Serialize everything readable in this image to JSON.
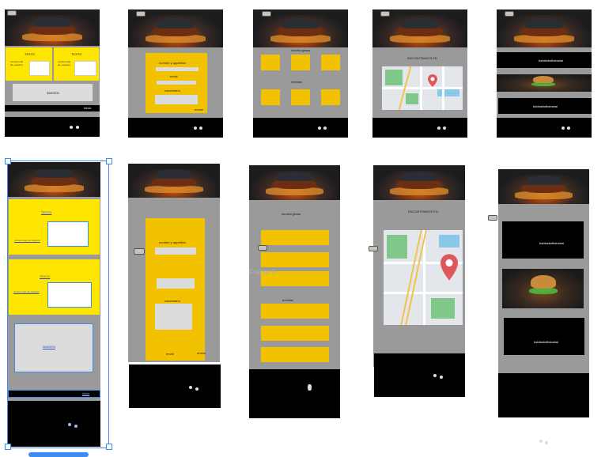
{
  "desktop": {
    "f1": {
      "box1_title": "TEXTO",
      "box1_body": "conoce mas de nosotros",
      "box2_title": "TEXTO",
      "box2_body": "conoce mas de nosotros",
      "image_label": "IMAGEN",
      "inicio": "Inicio"
    },
    "f2": {
      "name_label": "nombre y appellido",
      "email_label": "email",
      "comment_label": "comentario",
      "send_label": "enviar"
    },
    "f3": {
      "hamburgers_label": "hamburgesas",
      "drinks_label": "bebidas"
    },
    "f4": {
      "title": "ENCONTRANOS EN"
    },
    "f5": {
      "card1": "bsbfasbsfbsbsbai",
      "card2": "bsbfasbsfbsbsbai"
    }
  },
  "mobile": {
    "m1": {
      "box1_title": "TEXTO",
      "box1_body": "conoce mas de nosotros",
      "box2_title": "TEXTO",
      "box2_body": "conoce mas de nosotros",
      "image_label": "IMAGEN",
      "inicio": "inicio"
    },
    "m2": {
      "name_label": "nombre y appellido",
      "comment_label": "comentario",
      "email_label": "email",
      "send_label": "enviar"
    },
    "m3": {
      "hamburgers_label": "hamburgesas",
      "drinks_label": "bebidas",
      "frame_label": "Frame 1"
    },
    "m4": {
      "title": "ENCONTRANOS EN"
    },
    "m5": {
      "card1": "bsbfasbsfbsbsbai",
      "card2": "bsbfasbsfbsbsbai"
    }
  },
  "colors": {
    "yellow": "#f2c100",
    "bright_yellow": "#ffe600",
    "frame_grey": "#9a9a9a",
    "selection_blue": "#3b8cf0"
  },
  "icons": [
    "logo-icon",
    "map-pin-icon",
    "social-dot-icon"
  ]
}
